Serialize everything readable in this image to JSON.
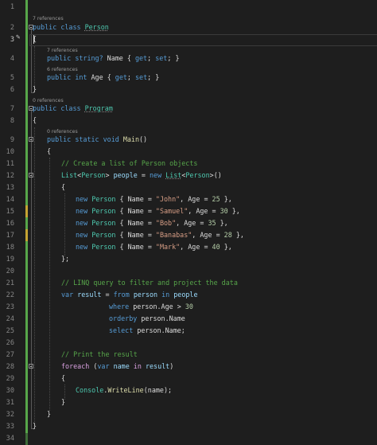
{
  "editor": {
    "line_numbers": [
      "1",
      "2",
      "3",
      "4",
      "5",
      "6",
      "7",
      "8",
      "9",
      "10",
      "11",
      "12",
      "13",
      "14",
      "15",
      "16",
      "17",
      "18",
      "19",
      "20",
      "21",
      "22",
      "23",
      "24",
      "25",
      "26",
      "27",
      "28",
      "29",
      "30",
      "31",
      "32",
      "33",
      "34"
    ],
    "codelens": {
      "person_refs": "7 references",
      "name_refs": "7 references",
      "age_refs": "6 references",
      "program_refs": "0 references",
      "main_refs": "0 references"
    },
    "lines": {
      "l2": {
        "kw1": "public",
        "kw2": "class",
        "name": "Person"
      },
      "l3": {
        "text": "{"
      },
      "l4": {
        "kw1": "public",
        "kw2": "string?",
        "name": "Name",
        "open": "{",
        "get": "get",
        "semi1": ";",
        "set": "set",
        "semi2": ";",
        "close": "}"
      },
      "l5": {
        "kw1": "public",
        "kw2": "int",
        "name": "Age",
        "open": "{",
        "get": "get",
        "semi1": ";",
        "set": "set",
        "semi2": ";",
        "close": "}"
      },
      "l6": {
        "text": "}"
      },
      "l7": {
        "kw1": "public",
        "kw2": "class",
        "name": "Program"
      },
      "l8": {
        "text": "{"
      },
      "l9": {
        "kw1": "public",
        "kw2": "static",
        "kw3": "void",
        "name": "Main",
        "rest": "()"
      },
      "l10": {
        "text": "{"
      },
      "l11": {
        "comment": "// Create a list of Person objects"
      },
      "l12": {
        "type": "List",
        "lt": "<",
        "generic": "Person",
        "gt": ">",
        "var": "people",
        "eq": "=",
        "new": "new",
        "type2": "List",
        "lt2": "<",
        "generic2": "Person",
        "gt2": ">",
        "tail": "()"
      },
      "l13": {
        "text": "{"
      },
      "people": [
        {
          "name": "\"John\"",
          "age": "25"
        },
        {
          "name": "\"Samuel\"",
          "age": "30"
        },
        {
          "name": "\"Bob\"",
          "age": "35"
        },
        {
          "name": "\"Banabas\"",
          "age": "28"
        },
        {
          "name": "\"Mark\"",
          "age": "40"
        }
      ],
      "person_line": {
        "new": "new",
        "type": "Person",
        "open": "{",
        "name_prop": "Name",
        "eq": "=",
        "comma": ",",
        "age_prop": "Age",
        "close": "},"
      },
      "l19": {
        "text": "};"
      },
      "l21": {
        "comment": "// LINQ query to filter and project the data"
      },
      "l22": {
        "kw": "var",
        "var": "result",
        "eq": "=",
        "from": "from",
        "range": "person",
        "in": "in",
        "source": "people"
      },
      "l23": {
        "where": "where",
        "expr": "person.Age",
        "op": ">",
        "num": "30"
      },
      "l24": {
        "orderby": "orderby",
        "expr": "person.Name"
      },
      "l25": {
        "select": "select",
        "expr": "person.Name;"
      },
      "l27": {
        "comment": "// Print the result"
      },
      "l28": {
        "foreach": "foreach",
        "open": "(",
        "var": "var",
        "name": "name",
        "in": "in",
        "src": "result",
        "close": ")"
      },
      "l29": {
        "text": "{"
      },
      "l30": {
        "cls": "Console",
        "dot": ".",
        "mth": "WriteLine",
        "args": "(name);"
      },
      "l31": {
        "text": "}"
      },
      "l32": {
        "text": "}"
      },
      "l33": {
        "text": "}"
      }
    },
    "colors": {
      "background": "#1e1e1e",
      "keyword": "#569cd6",
      "type": "#4ec9b0",
      "string": "#d69d85",
      "number": "#b5cea8",
      "comment": "#57a64a",
      "method": "#dcdcaa",
      "control": "#d8a0df",
      "change_bar": "#57a64a"
    },
    "icons": [
      "pencil-icon",
      "fold-toggle-icon"
    ]
  }
}
